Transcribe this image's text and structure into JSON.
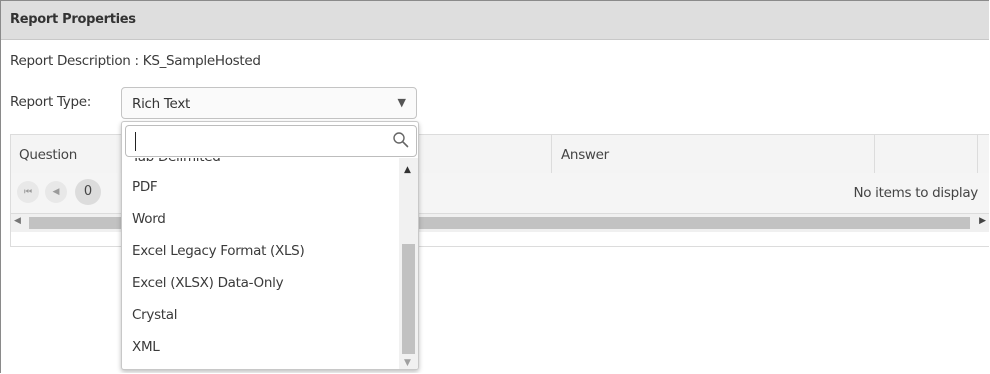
{
  "panel": {
    "title": "Report Properties",
    "description": "Report Description : KS_SampleHosted",
    "report_type_label": "Report Type:"
  },
  "report_type": {
    "selected": "Rich Text",
    "search_value": "",
    "options": [
      "Tab Delimited",
      "PDF",
      "Word",
      "Excel Legacy Format (XLS)",
      "Excel (XLSX) Data-Only",
      "Crystal",
      "XML"
    ]
  },
  "grid": {
    "columns": [
      "Question",
      "Answer"
    ],
    "page_number": "0",
    "empty_message": "No items to display"
  },
  "colors": {
    "title_bar": "#dedede",
    "header_bg": "#f4f4f4",
    "scroll_thumb": "#c1c1c1"
  }
}
